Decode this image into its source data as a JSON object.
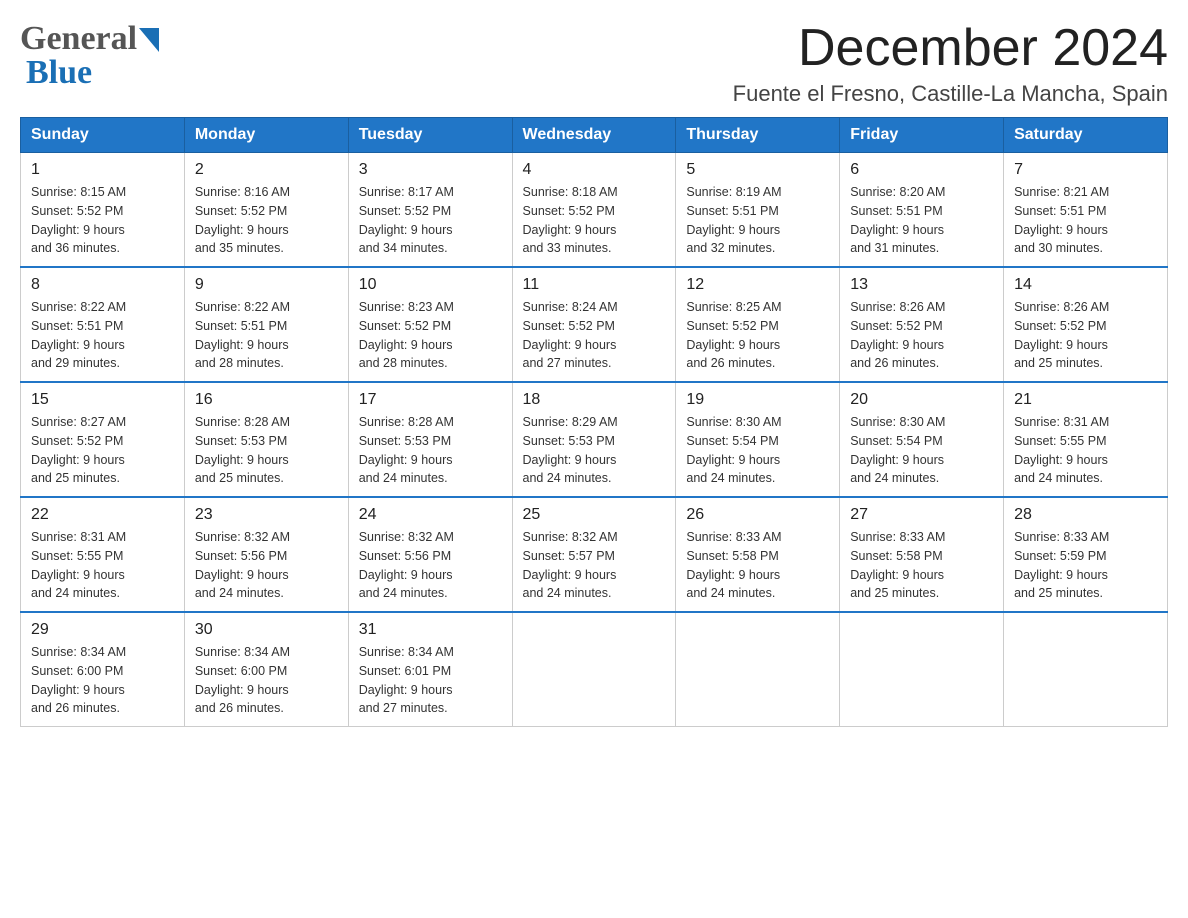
{
  "header": {
    "title": "December 2024",
    "subtitle": "Fuente el Fresno, Castille-La Mancha, Spain"
  },
  "logo": {
    "line1": "General",
    "line2": "Blue"
  },
  "weekdays": [
    "Sunday",
    "Monday",
    "Tuesday",
    "Wednesday",
    "Thursday",
    "Friday",
    "Saturday"
  ],
  "weeks": [
    [
      {
        "day": "1",
        "sunrise": "8:15 AM",
        "sunset": "5:52 PM",
        "daylight": "9 hours and 36 minutes."
      },
      {
        "day": "2",
        "sunrise": "8:16 AM",
        "sunset": "5:52 PM",
        "daylight": "9 hours and 35 minutes."
      },
      {
        "day": "3",
        "sunrise": "8:17 AM",
        "sunset": "5:52 PM",
        "daylight": "9 hours and 34 minutes."
      },
      {
        "day": "4",
        "sunrise": "8:18 AM",
        "sunset": "5:52 PM",
        "daylight": "9 hours and 33 minutes."
      },
      {
        "day": "5",
        "sunrise": "8:19 AM",
        "sunset": "5:51 PM",
        "daylight": "9 hours and 32 minutes."
      },
      {
        "day": "6",
        "sunrise": "8:20 AM",
        "sunset": "5:51 PM",
        "daylight": "9 hours and 31 minutes."
      },
      {
        "day": "7",
        "sunrise": "8:21 AM",
        "sunset": "5:51 PM",
        "daylight": "9 hours and 30 minutes."
      }
    ],
    [
      {
        "day": "8",
        "sunrise": "8:22 AM",
        "sunset": "5:51 PM",
        "daylight": "9 hours and 29 minutes."
      },
      {
        "day": "9",
        "sunrise": "8:22 AM",
        "sunset": "5:51 PM",
        "daylight": "9 hours and 28 minutes."
      },
      {
        "day": "10",
        "sunrise": "8:23 AM",
        "sunset": "5:52 PM",
        "daylight": "9 hours and 28 minutes."
      },
      {
        "day": "11",
        "sunrise": "8:24 AM",
        "sunset": "5:52 PM",
        "daylight": "9 hours and 27 minutes."
      },
      {
        "day": "12",
        "sunrise": "8:25 AM",
        "sunset": "5:52 PM",
        "daylight": "9 hours and 26 minutes."
      },
      {
        "day": "13",
        "sunrise": "8:26 AM",
        "sunset": "5:52 PM",
        "daylight": "9 hours and 26 minutes."
      },
      {
        "day": "14",
        "sunrise": "8:26 AM",
        "sunset": "5:52 PM",
        "daylight": "9 hours and 25 minutes."
      }
    ],
    [
      {
        "day": "15",
        "sunrise": "8:27 AM",
        "sunset": "5:52 PM",
        "daylight": "9 hours and 25 minutes."
      },
      {
        "day": "16",
        "sunrise": "8:28 AM",
        "sunset": "5:53 PM",
        "daylight": "9 hours and 25 minutes."
      },
      {
        "day": "17",
        "sunrise": "8:28 AM",
        "sunset": "5:53 PM",
        "daylight": "9 hours and 24 minutes."
      },
      {
        "day": "18",
        "sunrise": "8:29 AM",
        "sunset": "5:53 PM",
        "daylight": "9 hours and 24 minutes."
      },
      {
        "day": "19",
        "sunrise": "8:30 AM",
        "sunset": "5:54 PM",
        "daylight": "9 hours and 24 minutes."
      },
      {
        "day": "20",
        "sunrise": "8:30 AM",
        "sunset": "5:54 PM",
        "daylight": "9 hours and 24 minutes."
      },
      {
        "day": "21",
        "sunrise": "8:31 AM",
        "sunset": "5:55 PM",
        "daylight": "9 hours and 24 minutes."
      }
    ],
    [
      {
        "day": "22",
        "sunrise": "8:31 AM",
        "sunset": "5:55 PM",
        "daylight": "9 hours and 24 minutes."
      },
      {
        "day": "23",
        "sunrise": "8:32 AM",
        "sunset": "5:56 PM",
        "daylight": "9 hours and 24 minutes."
      },
      {
        "day": "24",
        "sunrise": "8:32 AM",
        "sunset": "5:56 PM",
        "daylight": "9 hours and 24 minutes."
      },
      {
        "day": "25",
        "sunrise": "8:32 AM",
        "sunset": "5:57 PM",
        "daylight": "9 hours and 24 minutes."
      },
      {
        "day": "26",
        "sunrise": "8:33 AM",
        "sunset": "5:58 PM",
        "daylight": "9 hours and 24 minutes."
      },
      {
        "day": "27",
        "sunrise": "8:33 AM",
        "sunset": "5:58 PM",
        "daylight": "9 hours and 25 minutes."
      },
      {
        "day": "28",
        "sunrise": "8:33 AM",
        "sunset": "5:59 PM",
        "daylight": "9 hours and 25 minutes."
      }
    ],
    [
      {
        "day": "29",
        "sunrise": "8:34 AM",
        "sunset": "6:00 PM",
        "daylight": "9 hours and 26 minutes."
      },
      {
        "day": "30",
        "sunrise": "8:34 AM",
        "sunset": "6:00 PM",
        "daylight": "9 hours and 26 minutes."
      },
      {
        "day": "31",
        "sunrise": "8:34 AM",
        "sunset": "6:01 PM",
        "daylight": "9 hours and 27 minutes."
      },
      null,
      null,
      null,
      null
    ]
  ]
}
